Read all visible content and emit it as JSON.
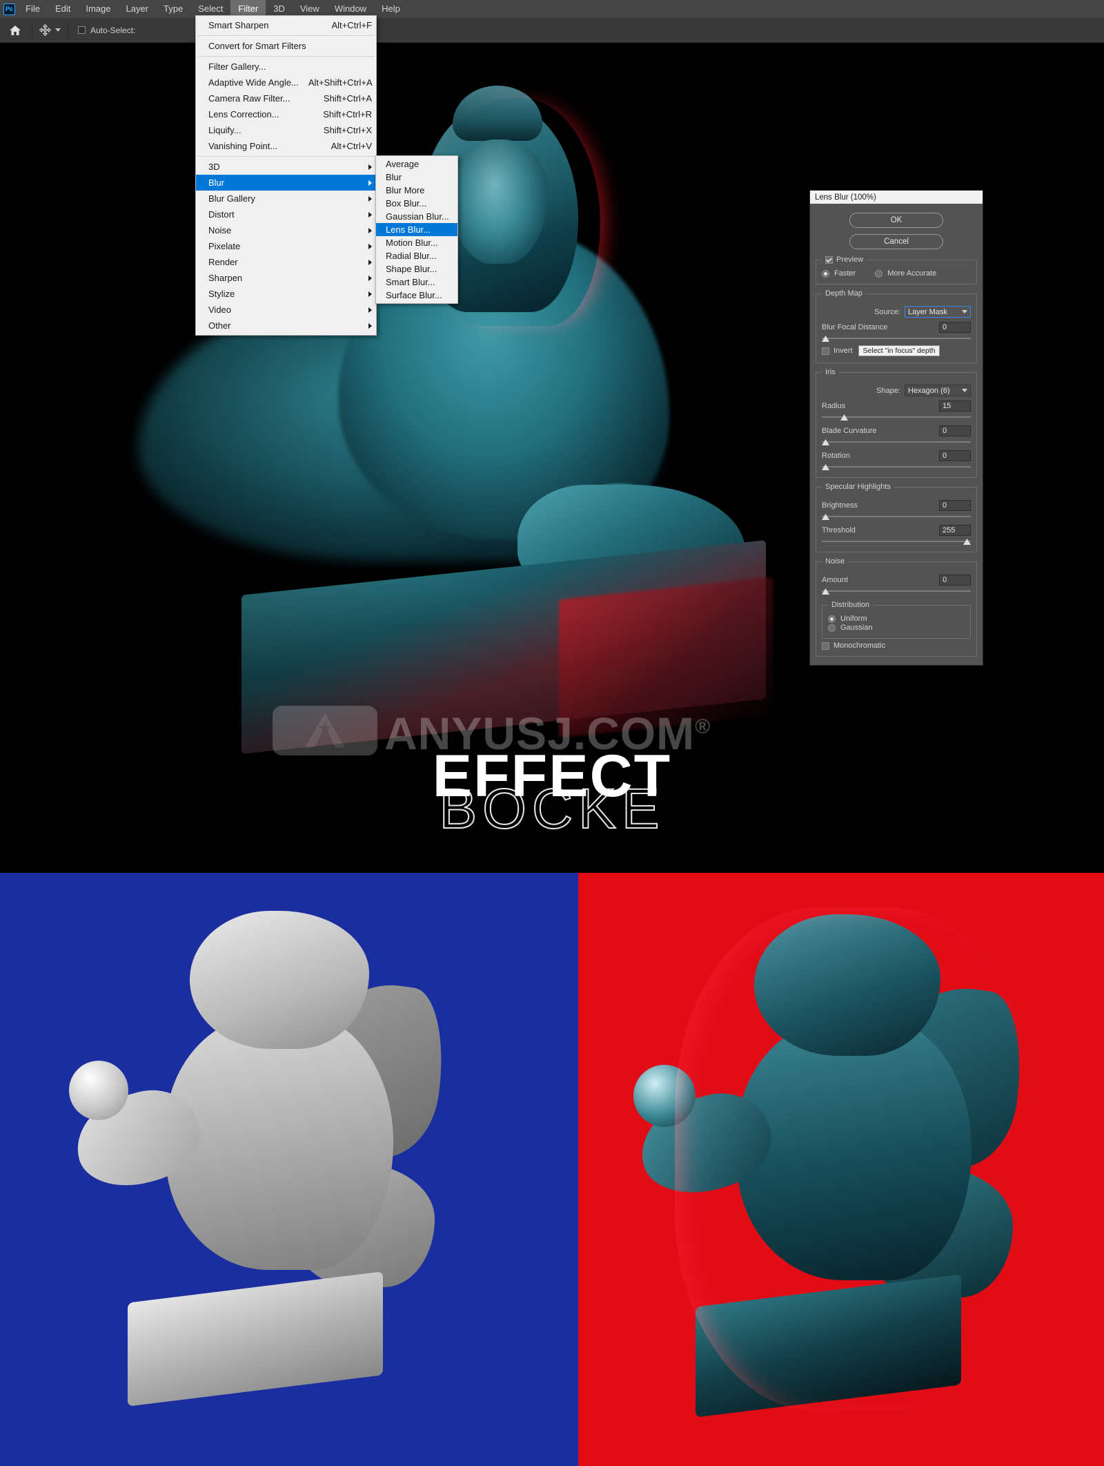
{
  "app": {
    "logo": "Ps",
    "menubar": [
      "File",
      "Edit",
      "Image",
      "Layer",
      "Type",
      "Select",
      "Filter",
      "3D",
      "View",
      "Window",
      "Help"
    ],
    "active_menu": "Filter"
  },
  "options_bar": {
    "home_icon": "home-icon",
    "tool_icon": "move-tool-icon",
    "auto_select_label": "Auto-Select:"
  },
  "filter_menu": {
    "groups": [
      [
        {
          "label": "Smart Sharpen",
          "shortcut": "Alt+Ctrl+F",
          "submenu": false
        }
      ],
      [
        {
          "label": "Convert for Smart Filters",
          "shortcut": "",
          "submenu": false
        }
      ],
      [
        {
          "label": "Filter Gallery...",
          "shortcut": "",
          "submenu": false
        },
        {
          "label": "Adaptive Wide Angle...",
          "shortcut": "Alt+Shift+Ctrl+A",
          "submenu": false
        },
        {
          "label": "Camera Raw Filter...",
          "shortcut": "Shift+Ctrl+A",
          "submenu": false
        },
        {
          "label": "Lens Correction...",
          "shortcut": "Shift+Ctrl+R",
          "submenu": false
        },
        {
          "label": "Liquify...",
          "shortcut": "Shift+Ctrl+X",
          "submenu": false
        },
        {
          "label": "Vanishing Point...",
          "shortcut": "Alt+Ctrl+V",
          "submenu": false
        }
      ],
      [
        {
          "label": "3D",
          "shortcut": "",
          "submenu": true
        },
        {
          "label": "Blur",
          "shortcut": "",
          "submenu": true,
          "selected": true
        },
        {
          "label": "Blur Gallery",
          "shortcut": "",
          "submenu": true
        },
        {
          "label": "Distort",
          "shortcut": "",
          "submenu": true
        },
        {
          "label": "Noise",
          "shortcut": "",
          "submenu": true
        },
        {
          "label": "Pixelate",
          "shortcut": "",
          "submenu": true
        },
        {
          "label": "Render",
          "shortcut": "",
          "submenu": true
        },
        {
          "label": "Sharpen",
          "shortcut": "",
          "submenu": true
        },
        {
          "label": "Stylize",
          "shortcut": "",
          "submenu": true
        },
        {
          "label": "Video",
          "shortcut": "",
          "submenu": true
        },
        {
          "label": "Other",
          "shortcut": "",
          "submenu": true
        }
      ]
    ]
  },
  "blur_submenu": {
    "items": [
      {
        "label": "Average"
      },
      {
        "label": "Blur"
      },
      {
        "label": "Blur More"
      },
      {
        "label": "Box Blur..."
      },
      {
        "label": "Gaussian Blur..."
      },
      {
        "label": "Lens Blur...",
        "selected": true
      },
      {
        "label": "Motion Blur..."
      },
      {
        "label": "Radial Blur..."
      },
      {
        "label": "Shape Blur..."
      },
      {
        "label": "Smart Blur..."
      },
      {
        "label": "Surface Blur..."
      }
    ]
  },
  "lens_blur_dialog": {
    "title": "Lens Blur (100%)",
    "ok_label": "OK",
    "cancel_label": "Cancel",
    "preview_label": "Preview",
    "preview_checked": true,
    "faster_label": "Faster",
    "more_accurate_label": "More Accurate",
    "quality_selected": "Faster",
    "depth_map": {
      "legend": "Depth Map",
      "source_label": "Source:",
      "source_value": "Layer Mask",
      "blur_focal_distance_label": "Blur Focal Distance",
      "blur_focal_distance_value": "0",
      "invert_label": "Invert",
      "invert_checked": false,
      "select_focus_button": "Select \"in focus\" depth"
    },
    "iris": {
      "legend": "Iris",
      "shape_label": "Shape:",
      "shape_value": "Hexagon (6)",
      "radius_label": "Radius",
      "radius_value": "15",
      "blade_curvature_label": "Blade Curvature",
      "blade_curvature_value": "0",
      "rotation_label": "Rotation",
      "rotation_value": "0"
    },
    "specular": {
      "legend": "Specular Highlights",
      "brightness_label": "Brightness",
      "brightness_value": "0",
      "threshold_label": "Threshold",
      "threshold_value": "255"
    },
    "noise": {
      "legend": "Noise",
      "amount_label": "Amount",
      "amount_value": "0",
      "distribution_legend": "Distribution",
      "uniform_label": "Uniform",
      "gaussian_label": "Gaussian",
      "distribution_selected": "Uniform",
      "monochromatic_label": "Monochromatic",
      "monochromatic_checked": false
    }
  },
  "artwork": {
    "watermark_text": "ANYUSJ.COM",
    "watermark_reg": "®",
    "title_line1": "EFFECT",
    "title_line2": "BOCKE"
  },
  "colors": {
    "accent_blue": "#0078d7",
    "panel_grey": "#535353",
    "menubar_grey": "#454545",
    "blue_bg": "#1b2ea0",
    "red_bg": "#e00d17",
    "teal": "#2d7f8c"
  }
}
